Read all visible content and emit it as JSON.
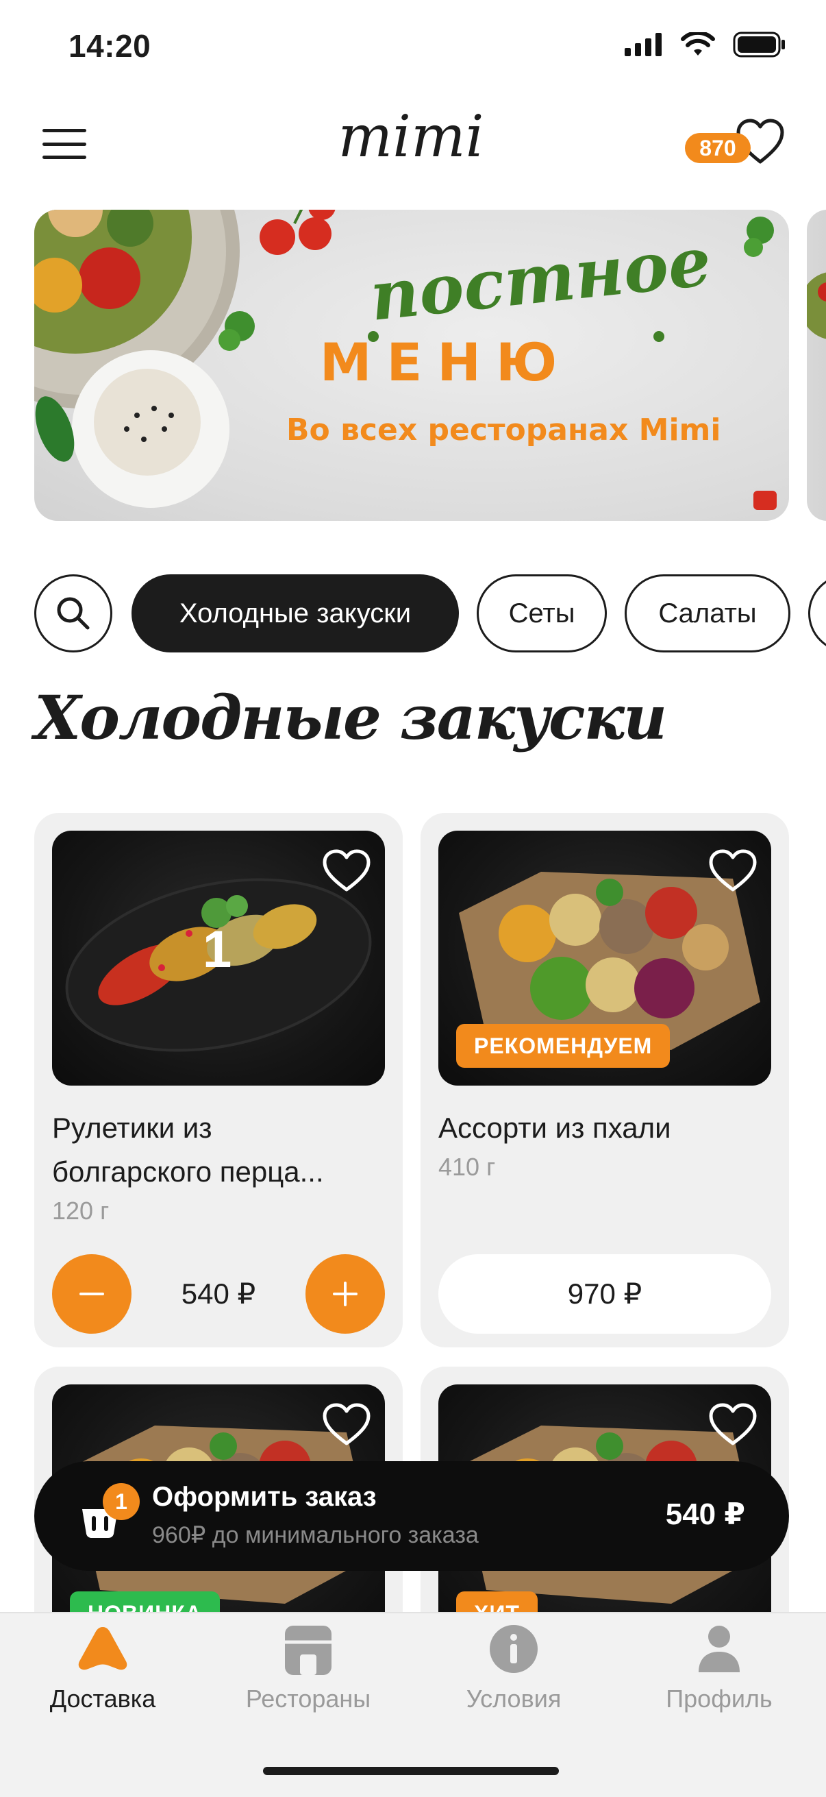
{
  "status_bar": {
    "time": "14:20"
  },
  "header": {
    "logo_text": "mimi",
    "favorites_count": "870"
  },
  "banner": {
    "script_text": "постное",
    "headline": "МЕНЮ",
    "subtitle": "Во всех ресторанах Mimi"
  },
  "categories": [
    {
      "label": "Холодные закуски",
      "active": true
    },
    {
      "label": "Сеты",
      "active": false
    },
    {
      "label": "Салаты",
      "active": false
    }
  ],
  "section": {
    "title": "Холодные закуски"
  },
  "products": [
    {
      "name": "Рулетики из болгарского перца...",
      "weight": "120 г",
      "price": "540 ₽",
      "quantity": "1",
      "tag": ""
    },
    {
      "name": "Ассорти из пхали",
      "weight": "410 г",
      "price": "970 ₽",
      "tag": "РЕКОМЕНДУЕМ"
    },
    {
      "tag": "НОВИНКА"
    },
    {
      "tag": "ХИТ"
    }
  ],
  "checkout": {
    "title": "Оформить заказ",
    "subtitle": "960₽ до минимального заказа",
    "total": "540 ₽",
    "cart_count": "1"
  },
  "tabs": [
    {
      "label": "Доставка",
      "icon": "delivery-icon",
      "active": true
    },
    {
      "label": "Рестораны",
      "icon": "restaurant-icon",
      "active": false
    },
    {
      "label": "Условия",
      "icon": "info-icon",
      "active": false
    },
    {
      "label": "Профиль",
      "icon": "profile-icon",
      "active": false
    }
  ],
  "colors": {
    "accent": "#f28a1c",
    "dark": "#1c1c1c",
    "new_tag": "#2dbb4e",
    "card_bg": "#f0f0f0",
    "muted": "#9a9a9a"
  }
}
